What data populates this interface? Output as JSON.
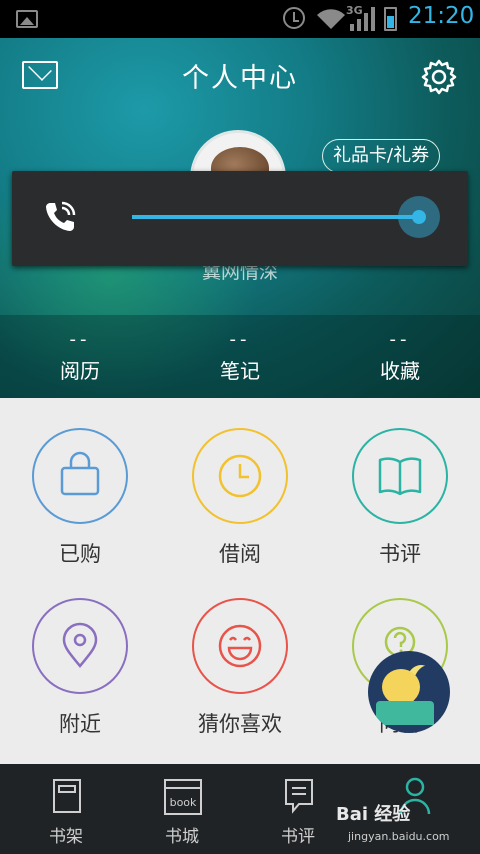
{
  "status_bar": {
    "network": "3G",
    "time": "21:20"
  },
  "header": {
    "title": "个人中心",
    "gift_button": "礼品卡/礼券",
    "username": "冀网情深",
    "stats": [
      {
        "value": "--",
        "label": "阅历"
      },
      {
        "value": "--",
        "label": "笔记"
      },
      {
        "value": "--",
        "label": "收藏"
      }
    ]
  },
  "volume_overlay": {
    "icon": "phone-call-icon",
    "level_fraction": 1.0,
    "accent_color": "#33b5e5"
  },
  "grid": [
    {
      "label": "已购",
      "icon": "shopping-bag-icon",
      "color": "#5b9bd5"
    },
    {
      "label": "借阅",
      "icon": "clock-icon",
      "color": "#f2c12e"
    },
    {
      "label": "书评",
      "icon": "open-book-icon",
      "color": "#2bb3a3"
    },
    {
      "label": "附近",
      "icon": "location-pin-icon",
      "color": "#8a6fc0"
    },
    {
      "label": "猜你喜欢",
      "icon": "smiley-icon",
      "color": "#e8534a"
    },
    {
      "label": "问答",
      "icon": "question-icon",
      "color": "#a9c94a"
    }
  ],
  "bottom_nav": [
    {
      "label": "书架",
      "icon": "bookshelf-icon"
    },
    {
      "label": "书城",
      "icon": "bookstore-icon",
      "icon_text": "book"
    },
    {
      "label": "书评",
      "icon": "comment-icon"
    },
    {
      "label": "",
      "icon": "person-icon"
    }
  ],
  "watermark": {
    "text": "Bai 经验",
    "sub": "jingyan.baidu.com"
  }
}
